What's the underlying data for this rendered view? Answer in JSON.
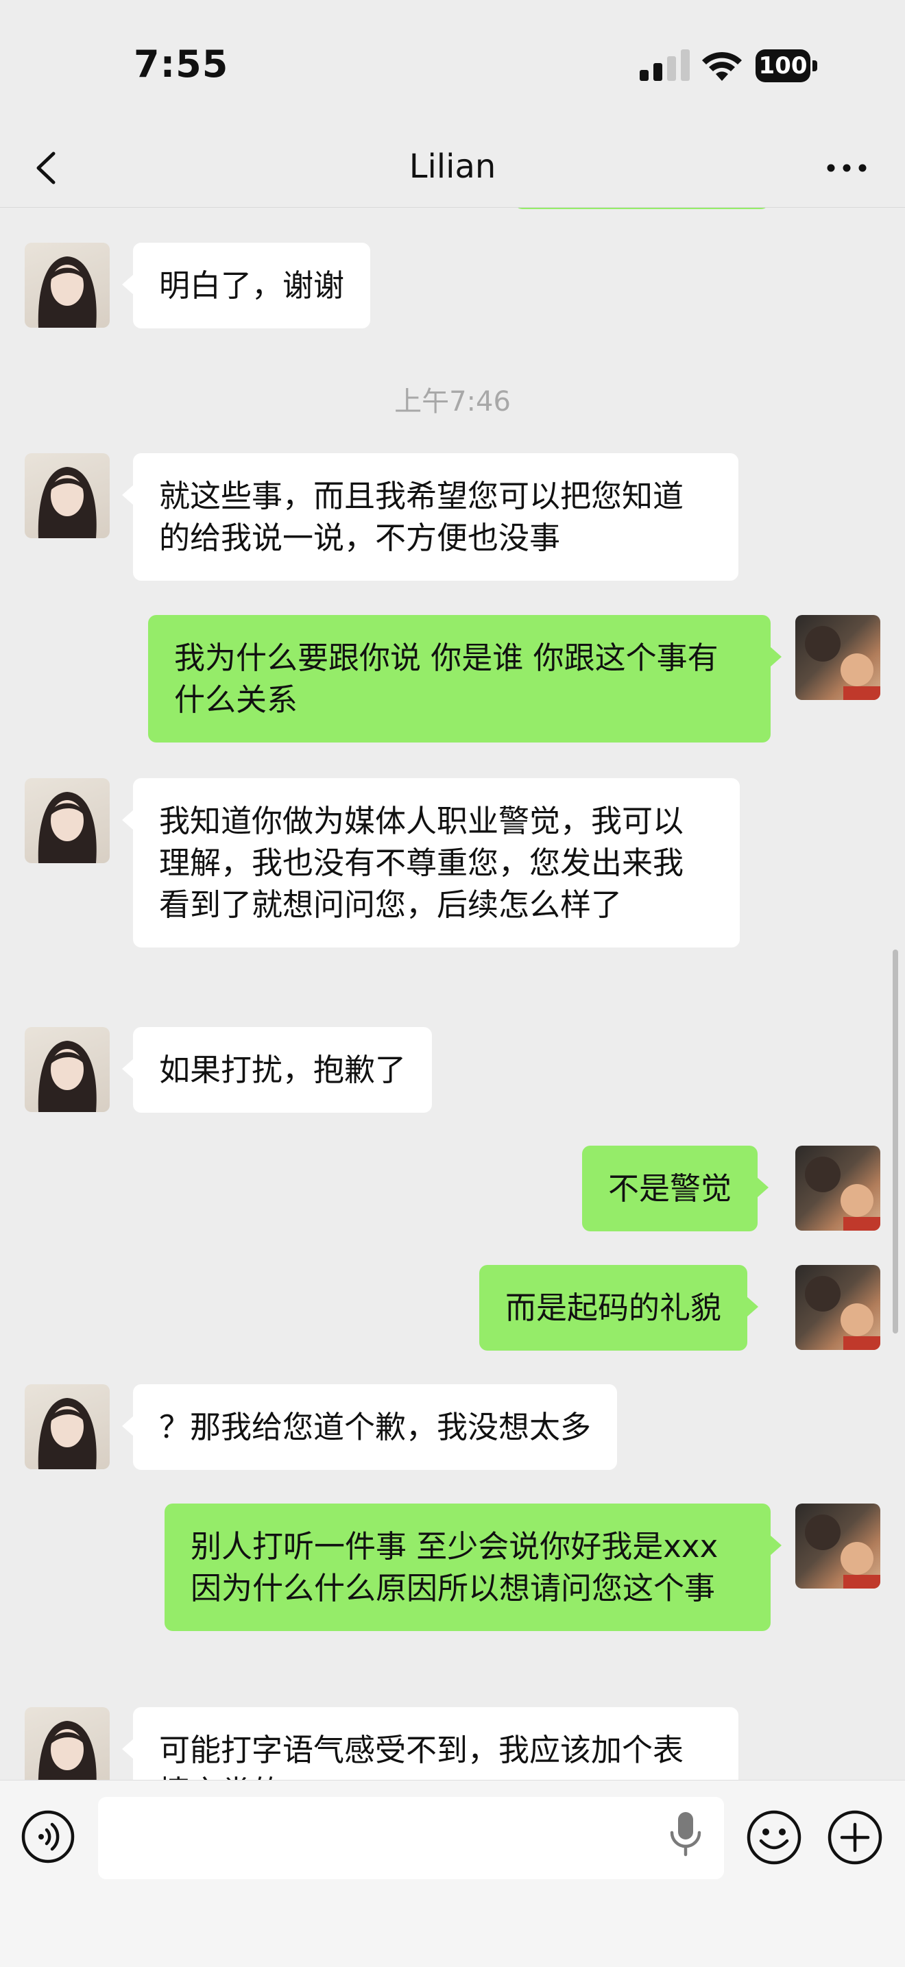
{
  "status_bar": {
    "time": "7:55",
    "battery": "100",
    "signal_icon": "cellular-signal-icon",
    "wifi_icon": "wifi-icon"
  },
  "nav": {
    "title": "Lilian",
    "back_icon": "chevron-left-icon",
    "more_icon": "more-dots-icon"
  },
  "messages": [
    {
      "side": "left",
      "text": "明白了，谢谢"
    },
    {
      "type": "timestamp",
      "text": "上午7:46"
    },
    {
      "side": "left",
      "text": "就这些事，而且我希望您可以把您知道的给我说一说，不方便也没事"
    },
    {
      "side": "right",
      "text": "我为什么要跟你说 你是谁 你跟这个事有什么关系"
    },
    {
      "side": "left",
      "text": "我知道你做为媒体人职业警觉，我可以理解，我也没有不尊重您，您发出来我看到了就想问问您，后续怎么样了"
    },
    {
      "side": "left",
      "text": "如果打扰，抱歉了"
    },
    {
      "side": "right",
      "text": "不是警觉"
    },
    {
      "side": "right",
      "text": "而是起码的礼貌"
    },
    {
      "side": "left",
      "text": "？那我给您道个歉，我没想太多"
    },
    {
      "side": "right",
      "text": "别人打听一件事 至少会说你好我是xxx 因为什么什么原因所以想请问您这个事"
    },
    {
      "side": "left",
      "text": "可能打字语气感受不到，我应该加个表情之类的"
    }
  ],
  "input_bar": {
    "voice_icon": "voice-input-icon",
    "mic_icon": "microphone-icon",
    "emoji_icon": "emoji-icon",
    "plus_icon": "plus-circle-icon"
  },
  "colors": {
    "background": "#ededed",
    "sent_bubble": "#95ec69",
    "received_bubble": "#ffffff"
  }
}
